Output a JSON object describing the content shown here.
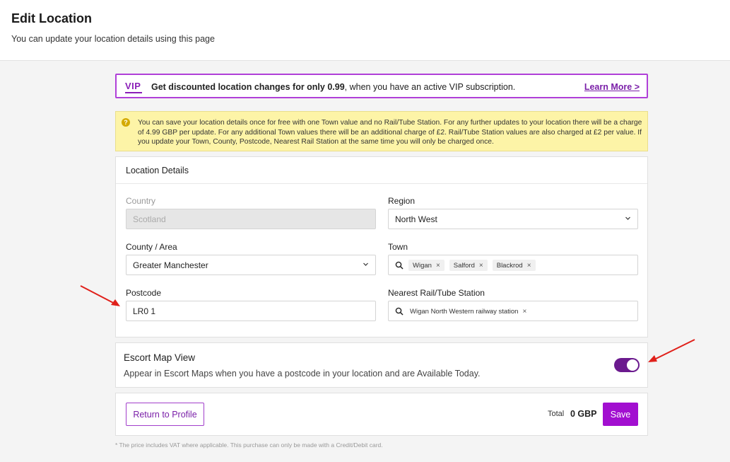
{
  "header": {
    "title": "Edit Location",
    "subtitle": "You can update your location details using this page"
  },
  "vip_banner": {
    "logo": "VIP",
    "text_bold": "Get discounted location changes for only 0.99",
    "text_rest": ", when you have an active VIP subscription.",
    "link": "Learn More >"
  },
  "notice": {
    "icon": "?",
    "text": "You can save your location details once for free with one Town value and no Rail/Tube Station. For any further updates to your location there will be a charge of 4.99 GBP per update. For any additional Town values there will be an additional charge of £2. Rail/Tube Station values are also charged at £2 per value. If you update your Town, County, Postcode, Nearest Rail Station at the same time you will only be charged once."
  },
  "location_details": {
    "title": "Location Details",
    "country": {
      "label": "Country",
      "value": "Scotland"
    },
    "region": {
      "label": "Region",
      "value": "North West"
    },
    "county": {
      "label": "County / Area",
      "value": "Greater Manchester"
    },
    "town": {
      "label": "Town",
      "chips": [
        "Wigan",
        "Salford",
        "Blackrod"
      ]
    },
    "postcode": {
      "label": "Postcode",
      "value": "LR0 1"
    },
    "station": {
      "label": "Nearest Rail/Tube Station",
      "chips": [
        "Wigan North Western railway station"
      ]
    }
  },
  "escort_map": {
    "title": "Escort Map View",
    "description": "Appear in Escort Maps when you have a postcode in your location and are Available Today."
  },
  "footer": {
    "return_label": "Return to Profile",
    "total_label": "Total",
    "total_value": "0 GBP",
    "save_label": "Save"
  },
  "footnote": "* The price includes VAT where applicable. This purchase can only be made with a Credit/Debit card.",
  "colors": {
    "accent": "#a20fd0",
    "accent_dark": "#6b1a8e",
    "notice_bg": "#fdf4a7",
    "annotation_arrow": "#e0201a"
  },
  "icons": [
    "help-circle-icon",
    "chevron-down-icon",
    "search-icon",
    "close-icon",
    "annotation-arrow"
  ]
}
